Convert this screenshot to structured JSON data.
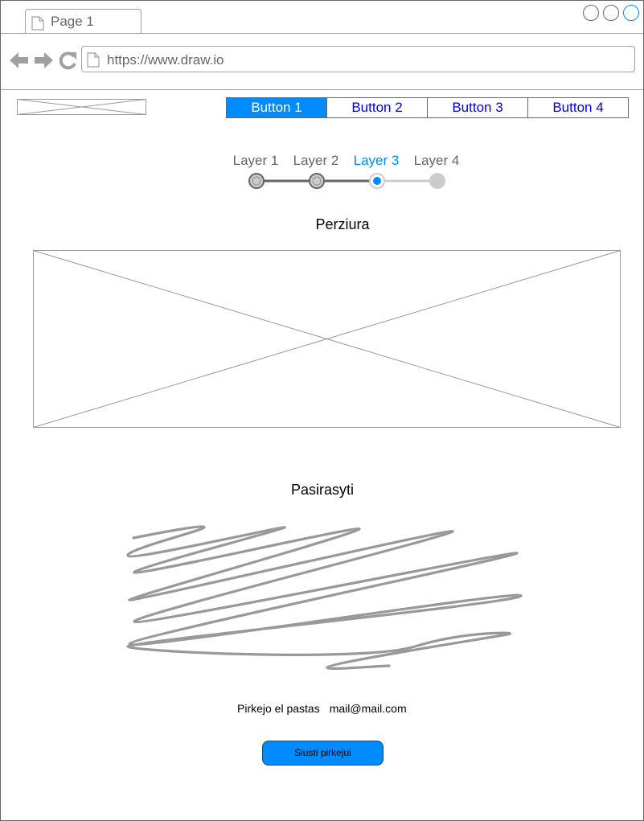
{
  "browser": {
    "tab_title": "Page 1",
    "url": "https://www.draw.io"
  },
  "button_bar": {
    "buttons": [
      "Button 1",
      "Button 2",
      "Button 3",
      "Button 4"
    ],
    "active_index": 0
  },
  "stepper": {
    "layers": [
      "Layer 1",
      "Layer 2",
      "Layer 3",
      "Layer 4"
    ],
    "current_index": 2
  },
  "preview": {
    "title": "Perziura"
  },
  "signature": {
    "title": "Pasirasyti"
  },
  "buyer_email": {
    "label": "Pirkejo el pastas",
    "value": "mail@mail.com"
  },
  "send_button": {
    "label": "Siusti pirkejui"
  },
  "colors": {
    "accent": "#008cff",
    "link": "#0000ee",
    "muted": "#666666",
    "border": "#a0a0a0"
  },
  "icons": [
    "page-icon",
    "back-arrow-icon",
    "forward-arrow-icon",
    "reload-icon"
  ]
}
